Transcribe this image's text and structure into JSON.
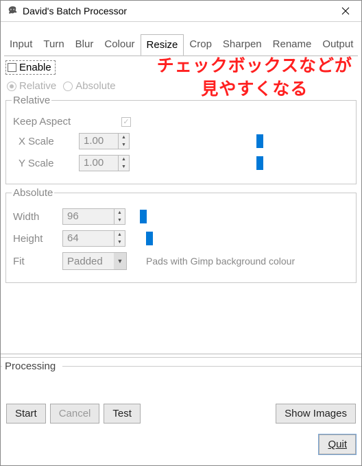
{
  "window": {
    "title": "David's Batch Processor"
  },
  "tabs": [
    "Input",
    "Turn",
    "Blur",
    "Colour",
    "Resize",
    "Crop",
    "Sharpen",
    "Rename",
    "Output"
  ],
  "active_tab": "Resize",
  "resize": {
    "enable_label": "Enable",
    "mode": {
      "relative": "Relative",
      "absolute": "Absolute"
    },
    "relative": {
      "legend": "Relative",
      "keep_aspect": "Keep Aspect",
      "xscale_label": "X Scale",
      "xscale_value": "1.00",
      "xscale_pos": 0.55,
      "yscale_label": "Y Scale",
      "yscale_value": "1.00",
      "yscale_pos": 0.55
    },
    "absolute": {
      "legend": "Absolute",
      "width_label": "Width",
      "width_value": "96",
      "width_pos": 0.01,
      "height_label": "Height",
      "height_value": "64",
      "height_pos": 0.04,
      "fit_label": "Fit",
      "fit_value": "Padded",
      "fit_hint": "Pads with Gimp background colour"
    }
  },
  "annotation": "チェックボックスなどが\n見やすくなる",
  "processing": {
    "legend": "Processing"
  },
  "buttons": {
    "start": "Start",
    "cancel": "Cancel",
    "test": "Test",
    "show": "Show Images",
    "quit": "Quit"
  }
}
